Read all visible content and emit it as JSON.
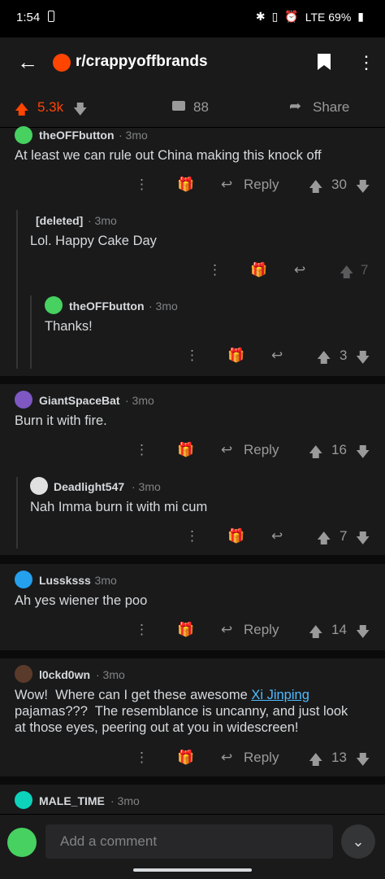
{
  "status": {
    "time": "1:54",
    "right": "LTE 69%"
  },
  "header": {
    "back_icon": "arrow-left-icon",
    "subreddit": "r/crappyoffbrands",
    "more_icon": "ellipsis-vertical-icon"
  },
  "post_bar": {
    "score": "5.3k",
    "comments": "88",
    "share": "Share"
  },
  "labels": {
    "reply": "Reply"
  },
  "comments": [
    {
      "author": "theOFFbutton",
      "age": "· 3mo",
      "body": "At least we can rule out China making this knock off",
      "score": "30"
    },
    {
      "author": "[deleted]",
      "age": "· 3mo",
      "body": "Lol. Happy Cake Day",
      "score": "7"
    },
    {
      "author": "theOFFbutton",
      "age": "· 3mo",
      "body": "Thanks!",
      "score": "3"
    },
    {
      "author": "GiantSpaceBat",
      "age": "· 3mo",
      "body": "Burn it with fire.",
      "score": "16"
    },
    {
      "author": "Deadlight547",
      "age": "· 3mo",
      "body": "Nah Imma burn it with mi cum",
      "score": "7"
    },
    {
      "author": "Lussksss",
      "age": "· 3mo",
      "body": "Ah yes wiener the poo",
      "score": "14"
    },
    {
      "author": "l0ckd0wn",
      "age": "· 3mo",
      "body_pre": "Wow!  Where can I get these awesome ",
      "body_link": "Xi Jinping",
      "body_line2": "pajamas???  The resemblance is uncanny, and just look",
      "body_line3": "at those eyes, peering out at you in widescreen!",
      "score": "13"
    },
    {
      "author": "MALE_TIME",
      "age": "· 3mo"
    }
  ],
  "composer": {
    "placeholder": "Add a comment"
  },
  "colors": {
    "upvote": "#ff4500",
    "link": "#4fbcff",
    "background": "#1a1a1b"
  }
}
